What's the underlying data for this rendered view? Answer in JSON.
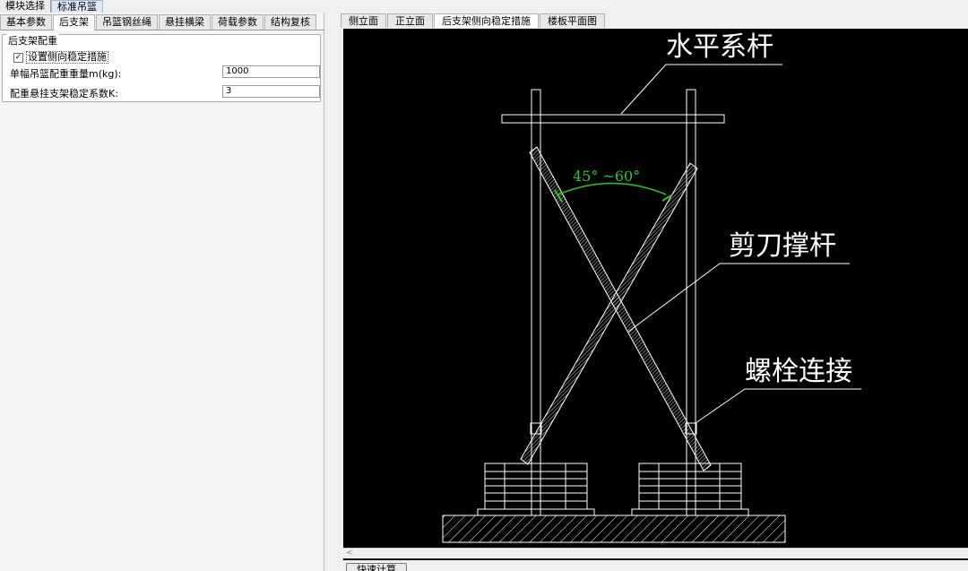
{
  "top_tabs": [
    "模块选择",
    "标准吊篮"
  ],
  "left_tabs": [
    "基本参数",
    "后支架",
    "吊篮钢丝绳",
    "悬挂横梁",
    "荷载参数",
    "结构复核"
  ],
  "group": {
    "title": "后支架配重",
    "checkbox_label": "设置侧向稳定措施",
    "checkbox_checked": true,
    "weight_label": "单幅吊篮配重重量m(kg):",
    "weight_value": "1000",
    "coef_label": "配重悬挂支架稳定系数K:",
    "coef_value": "3"
  },
  "right_tabs": [
    "侧立面",
    "正立面",
    "后支架侧向稳定措施",
    "楼板平面图"
  ],
  "drawing": {
    "label_tie": "水平系杆",
    "label_brace": "剪刀撑杆",
    "label_bolt": "螺栓连接",
    "angle_text": "45° ~60°",
    "line_color": "#ffffff",
    "angle_color": "#22cc22"
  },
  "calc_button": "快速计算"
}
